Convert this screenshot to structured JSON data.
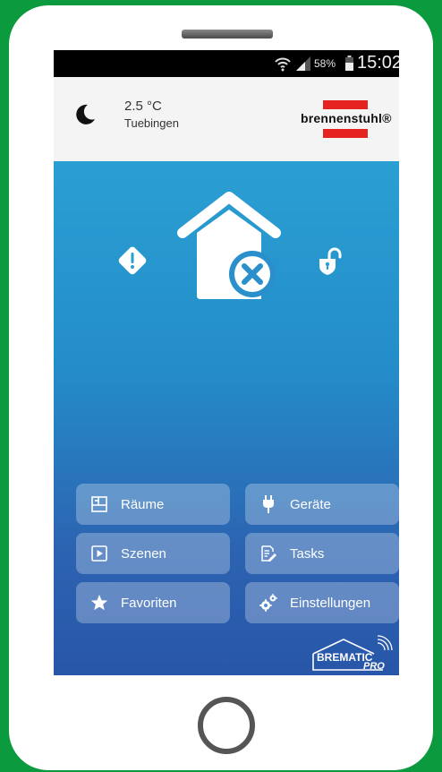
{
  "status_bar": {
    "battery": "58%",
    "time": "15:02",
    "wifi_icon": "wifi-icon",
    "signal_icon": "signal-icon",
    "battery_icon": "battery-icon"
  },
  "header": {
    "weather_icon": "moon-icon",
    "temperature": "2.5 °C",
    "location": "Tuebingen",
    "brand": "brennenstuhl®",
    "brand_color": "#e52320"
  },
  "status_icons": {
    "left": "warning-icon",
    "center": "home-disconnected-icon",
    "right": "unlocked-icon"
  },
  "menu": [
    {
      "label": "Räume",
      "icon": "rooms-icon"
    },
    {
      "label": "Geräte",
      "icon": "plug-icon"
    },
    {
      "label": "Szenen",
      "icon": "play-icon"
    },
    {
      "label": "Tasks",
      "icon": "task-icon"
    },
    {
      "label": "Favoriten",
      "icon": "star-icon"
    },
    {
      "label": "Einstellungen",
      "icon": "gears-icon"
    }
  ],
  "logo": {
    "name": "BREMATIC",
    "sub": "PRO"
  },
  "colors": {
    "frame": "#0b9a3e",
    "gradient_top": "#2a9fd3",
    "gradient_bottom": "#2856a8"
  }
}
